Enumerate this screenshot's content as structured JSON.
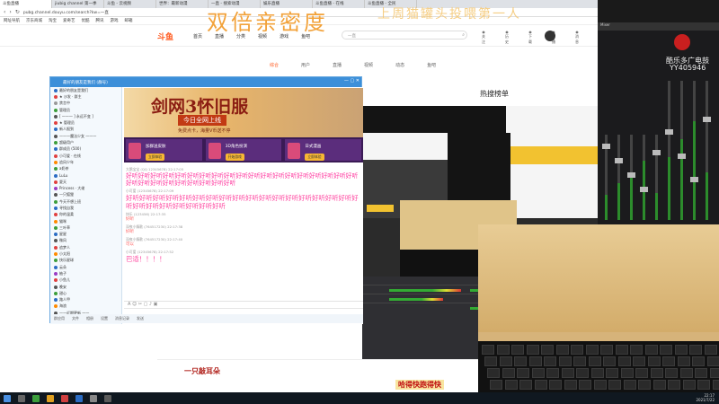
{
  "overlay": {
    "title": "双倍亲密度",
    "subtitle": "上周猫罐头投喂第一人"
  },
  "browser": {
    "tabs": [
      "斗鱼直播",
      "jiubig channel 第一季",
      "斗鱼 - 云视频",
      "世界：最新动漫",
      "一直 - 搜索动漫",
      "娱乐直播",
      "斗鱼直播 - 在线",
      "斗鱼直播 - 全民"
    ],
    "url": "pubg.channel.douyu.com/search?kw=一直",
    "bookmarks": [
      "网址导航",
      "京东商城",
      "淘宝",
      "爱奇艺",
      "优酷",
      "腾讯",
      "游戏",
      "邮箱"
    ]
  },
  "site": {
    "logo": "斗鱼",
    "nav": [
      "首页",
      "直播",
      "分类",
      "视频",
      "游戏",
      "鱼吧"
    ],
    "search_placeholder": "一直",
    "header_icons": [
      "关注",
      "历史",
      "下载",
      "开播",
      "消息"
    ],
    "tabs": [
      "综合",
      "用户",
      "直播",
      "视频",
      "动态",
      "鱼吧"
    ],
    "hot_rank": "热搜榜单"
  },
  "qq": {
    "title": "最好的朋友是我们 (群号)",
    "members": [
      {
        "name": "最好的朋友是我们",
        "color": "#2b6cc4"
      },
      {
        "name": "★ 沙发 · 群主",
        "color": "#e04040"
      },
      {
        "name": "禁言中",
        "color": "#999"
      },
      {
        "name": "管理员",
        "color": "#3c9e3c"
      },
      {
        "name": "[ 一一一 ] 永远不变 ]",
        "color": "#555"
      },
      {
        "name": "★ 管理员",
        "color": "#e04040"
      },
      {
        "name": "新人报到",
        "color": "#2b6cc4"
      },
      {
        "name": "一一一魔法少女 一一一",
        "color": "#555"
      },
      {
        "name": "超级用户",
        "color": "#3c9e3c"
      },
      {
        "name": "群成员 (500)",
        "color": "#2b6cc4"
      },
      {
        "name": "小可爱 · 在线",
        "color": "#e04040"
      },
      {
        "name": "追风少年",
        "color": "#ff8a00"
      },
      {
        "name": "a奶茶",
        "color": "#3c9e3c"
      },
      {
        "name": "LuLu",
        "color": "#2b6cc4"
      },
      {
        "name": "夏天",
        "color": "#e04040"
      },
      {
        "name": "Princess · 大佬",
        "color": "#9b3cc4"
      },
      {
        "name": "一只狐狸",
        "color": "#555"
      },
      {
        "name": "今天不想上班",
        "color": "#3c9e3c"
      },
      {
        "name": "寻找自我",
        "color": "#2b6cc4"
      },
      {
        "name": "你的温柔",
        "color": "#e04040"
      },
      {
        "name": "猫咪",
        "color": "#ff8a00"
      },
      {
        "name": "三叶草",
        "color": "#3c9e3c"
      },
      {
        "name": "星星",
        "color": "#2b6cc4"
      },
      {
        "name": "微风",
        "color": "#555"
      },
      {
        "name": "追梦人",
        "color": "#e04040"
      },
      {
        "name": "小太阳",
        "color": "#ff8a00"
      },
      {
        "name": "快乐星球",
        "color": "#3c9e3c"
      },
      {
        "name": "云朵",
        "color": "#2b6cc4"
      },
      {
        "name": "柚子",
        "color": "#9b3cc4"
      },
      {
        "name": "小鱼儿",
        "color": "#e04040"
      },
      {
        "name": "晚安",
        "color": "#555"
      },
      {
        "name": "甜心",
        "color": "#3c9e3c"
      },
      {
        "name": "路人甲",
        "color": "#2b6cc4"
      },
      {
        "name": "海浪",
        "color": "#ff8a00"
      },
      {
        "name": "一一近期更新 一一",
        "color": "#555"
      },
      {
        "name": "奶茶不加糖",
        "color": "#e04040"
      }
    ],
    "banner_title": "剑网3怀旧服",
    "banner_sub": "今日全网上线",
    "banner_sub2": "免费点卡，海量V币送不停",
    "ads": [
      {
        "text": "加群送皮肤",
        "btn": "立即体验"
      },
      {
        "text": "3D角色扮演",
        "btn": "开始游戏"
      },
      {
        "text": "日式漫画",
        "btn": "立即体验"
      }
    ],
    "messages": [
      {
        "meta": "大鹅宝宝 (QQ 12345678) 22:17:05",
        "body": "好听好听好听好听好听好听好听好听好听好听好听好听好听好听好听好听好听好听好听好听好听好听好听好听好听好听好听好听",
        "cls": ""
      },
      {
        "meta": "小可爱 (12345678) 22:17:09",
        "body": "好听好听好听好听好听好听好听好听好听好听好听好听好听好听好听好听好听好听好听好听好听好听好听好听好听",
        "cls": "big"
      },
      {
        "meta": "快乐 (123456) 22:17:35",
        "body": "好听",
        "cls": "small"
      },
      {
        "meta": "深夜小情歌 (764517230) 22:17:38",
        "body": "好听",
        "cls": "small"
      },
      {
        "meta": "深夜小情歌 (764517230) 22:17:40",
        "body": "可以",
        "cls": "small"
      },
      {
        "meta": "小可爱 (12345678) 22:17:52",
        "body": "巴适！！！！",
        "cls": "big"
      }
    ],
    "toolbar": "A ☺ ✂ ▢ ♪ ▣",
    "bottom": [
      "群应用",
      "文件",
      "相册",
      "设置",
      "消息记录",
      "发送"
    ]
  },
  "strip": {
    "left": "一只敲耳朵",
    "right": "哈得快跑得快"
  },
  "mixer": {
    "head": "Mixer",
    "name": "酷乐多广电鼓",
    "id": "YY405946"
  },
  "taskbar": {
    "time": "22:17",
    "date": "2021/7/22"
  }
}
